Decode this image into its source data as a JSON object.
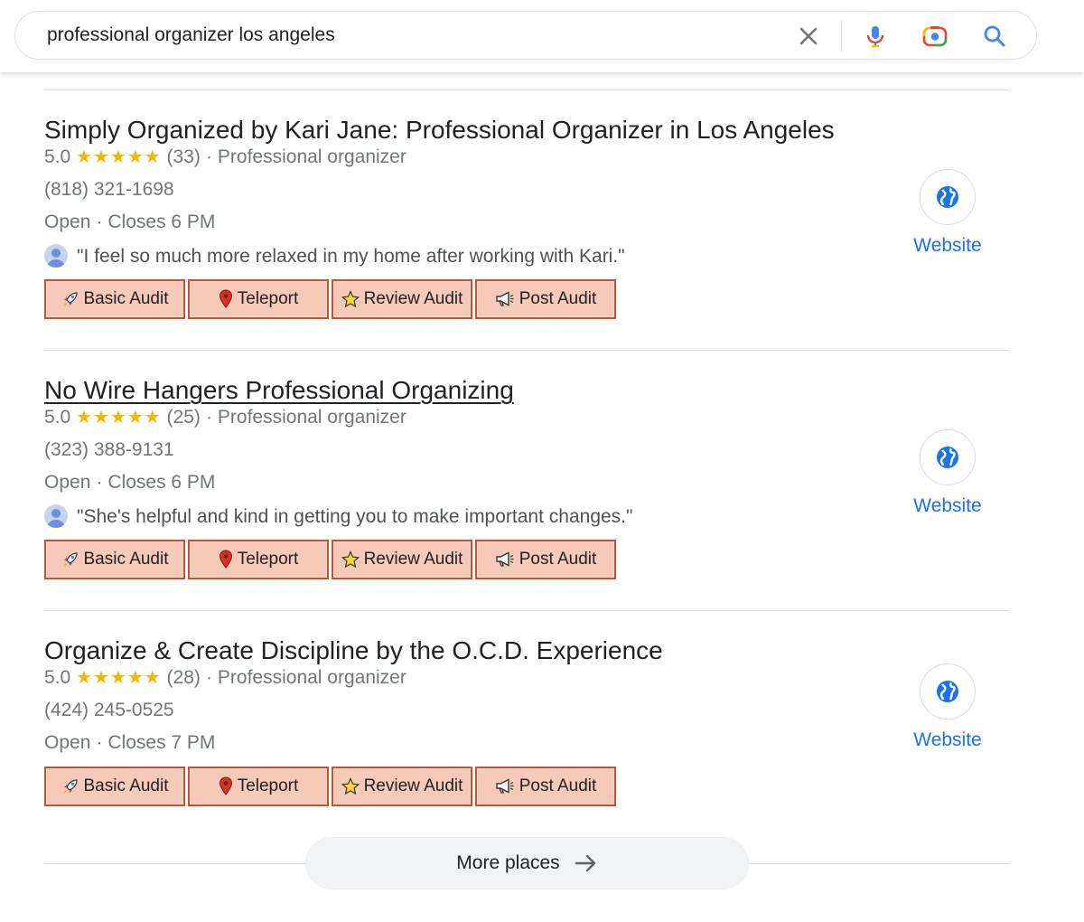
{
  "search": {
    "query": "professional organizer los angeles",
    "icons": [
      "close-icon",
      "mic-icon",
      "lens-icon",
      "search-icon"
    ]
  },
  "listings": [
    {
      "title": "Simply Organized by Kari Jane: Professional Organizer in Los Angeles",
      "rating": "5.0",
      "stars": "★★★★★",
      "reviews": "(33)",
      "separator": "·",
      "category": "Professional organizer",
      "phone": "(818) 321-1698",
      "status": "Open",
      "closes": "Closes 6 PM",
      "review_quote": "\"I feel so much more relaxed in my home after working with Kari.\"",
      "website_label": "Website"
    },
    {
      "title": "No Wire Hangers Professional Organizing",
      "rating": "5.0",
      "stars": "★★★★★",
      "reviews": "(25)",
      "separator": "·",
      "category": "Professional organizer",
      "phone": "(323) 388-9131",
      "status": "Open",
      "closes": "Closes 6 PM",
      "review_quote": "\"She's helpful and kind in getting you to make important changes.\"",
      "website_label": "Website"
    },
    {
      "title": "Organize & Create Discipline by the O.C.D. Experience",
      "rating": "5.0",
      "stars": "★★★★★",
      "reviews": "(28)",
      "separator": "·",
      "category": "Professional organizer",
      "phone": "(424) 245-0525",
      "status": "Open",
      "closes": "Closes 7 PM",
      "website_label": "Website"
    }
  ],
  "tools": {
    "basic_audit": "Basic Audit",
    "teleport": "Teleport",
    "review_audit": "Review Audit",
    "post_audit": "Post Audit"
  },
  "more": {
    "label": "More places"
  },
  "colors": {
    "star": "#f4b400",
    "link_blue": "#1a73e8",
    "tool_bg": "#f6c9b9",
    "tool_border": "#cf4f2c"
  }
}
